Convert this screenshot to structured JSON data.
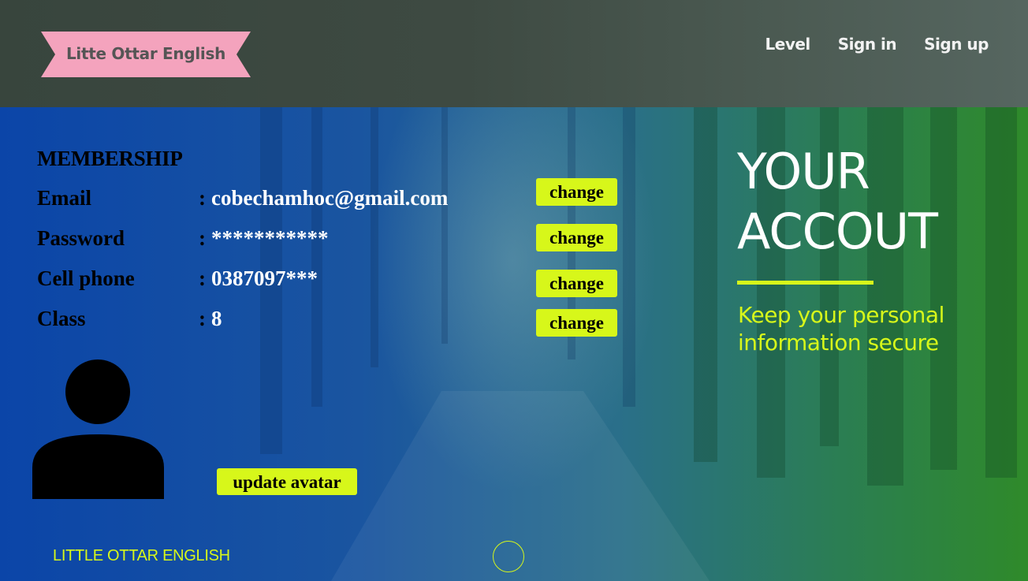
{
  "header": {
    "logo_text": "Litte Ottar English",
    "nav": [
      {
        "label": "Level"
      },
      {
        "label": "Sign in"
      },
      {
        "label": "Sign up"
      }
    ]
  },
  "account": {
    "section_title": "MEMBERSHIP",
    "separator": ":",
    "rows": [
      {
        "label": "Email",
        "value": "cobechamhoc@gmail.com",
        "action": "change"
      },
      {
        "label": "Password",
        "value": "***********",
        "action": "change"
      },
      {
        "label": "Cell phone",
        "value": "0387097***",
        "action": "change"
      },
      {
        "label": "Class",
        "value": "8",
        "action": "change"
      }
    ],
    "update_avatar_label": "update avatar"
  },
  "hero": {
    "title_line1": "YOUR",
    "title_line2": "ACCOUT",
    "subtitle": "Keep your personal information secure"
  },
  "footer": {
    "brand": "LITTLE OTTAR ENGLISH"
  },
  "colors": {
    "accent": "#d7f71a",
    "logo_ribbon": "#f4a3bd",
    "header_bg": "#3e4a42"
  },
  "icons": {
    "avatar": "person-silhouette-icon",
    "scroll": "circle-icon"
  }
}
